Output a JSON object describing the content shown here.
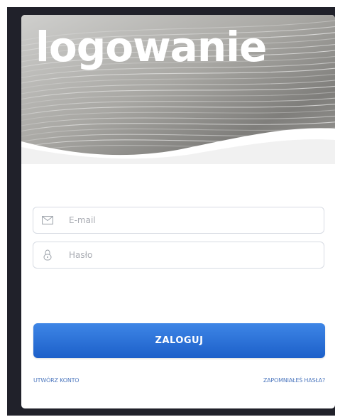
{
  "hero": {
    "title": "logowanie"
  },
  "form": {
    "email": {
      "placeholder": "E-mail",
      "icon": "envelope-icon"
    },
    "password": {
      "placeholder": "Hasło",
      "icon": "lock-icon"
    },
    "submit_label": "ZALOGUJ"
  },
  "links": {
    "create_account": "UTWÓRZ KONTO",
    "forgot_password": "ZAPOMNIAŁEŚ HASŁA?"
  },
  "colors": {
    "accent": "#2a6fd8",
    "link": "#4f79bf",
    "frame": "#20212a"
  }
}
